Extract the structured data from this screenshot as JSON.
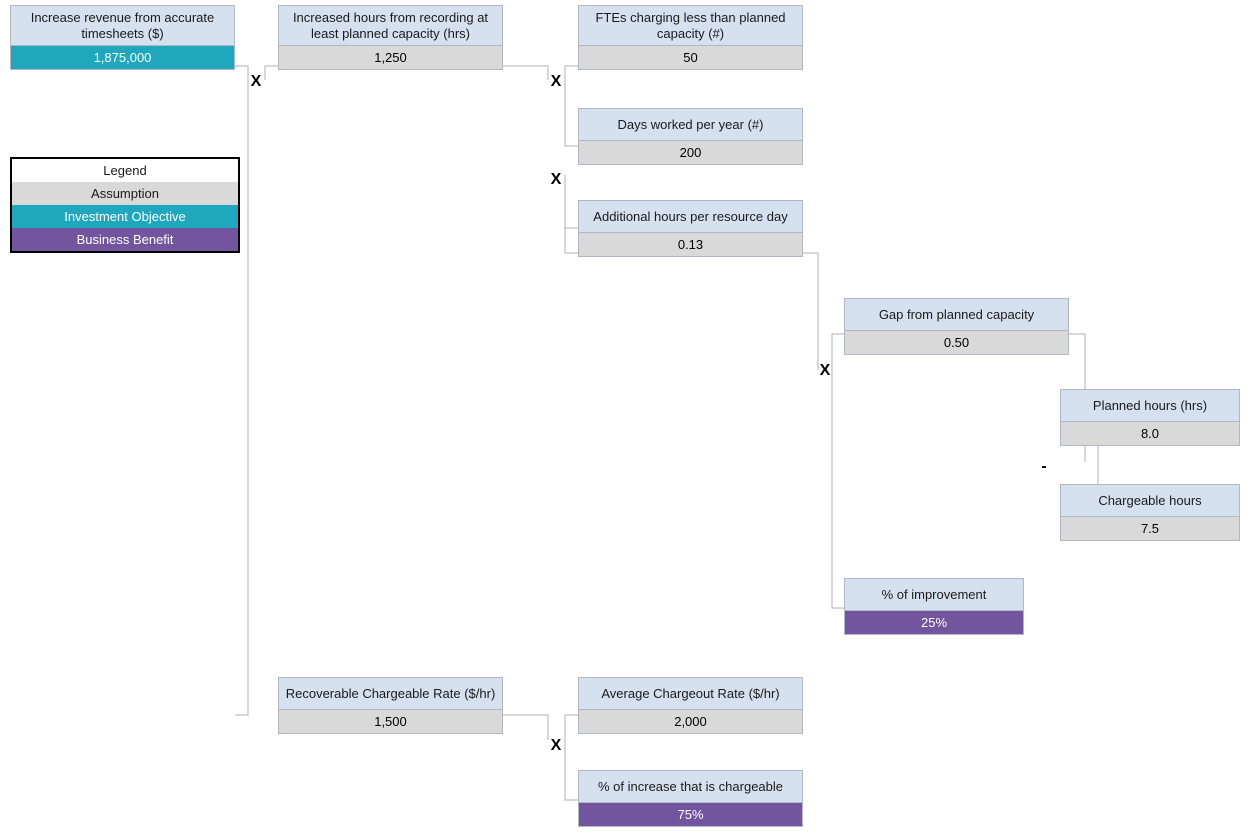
{
  "legend": {
    "title": "Legend",
    "assumption": "Assumption",
    "investment_objective": "Investment Objective",
    "business_benefit": "Business Benefit"
  },
  "nodes": {
    "revenue": {
      "title": "Increase revenue from accurate timesheets ($)",
      "value": "1,875,000"
    },
    "increased_hours": {
      "title": "Increased hours from recording at least planned capacity (hrs)",
      "value": "1,250"
    },
    "ftes_under": {
      "title": "FTEs charging less than planned capacity (#)",
      "value": "50"
    },
    "days_worked": {
      "title": "Days worked per year (#)",
      "value": "200"
    },
    "addl_hours_per_day": {
      "title": "Additional hours per resource day",
      "value": "0.13"
    },
    "gap_from_planned": {
      "title": "Gap from planned capacity",
      "value": "0.50"
    },
    "planned_hours": {
      "title": "Planned hours (hrs)",
      "value": "8.0"
    },
    "chargeable_hours": {
      "title": "Chargeable hours",
      "value": "7.5"
    },
    "pct_improvement": {
      "title": "% of improvement",
      "value": "25%"
    },
    "recoverable_rate": {
      "title": "Recoverable Chargeable Rate ($/hr)",
      "value": "1,500"
    },
    "avg_chargeout": {
      "title": "Average Chargeout Rate ($/hr)",
      "value": "2,000"
    },
    "pct_chargeable": {
      "title": "% of increase that is chargeable",
      "value": "75%"
    }
  },
  "ops": {
    "mult": "X",
    "minus": "-"
  }
}
